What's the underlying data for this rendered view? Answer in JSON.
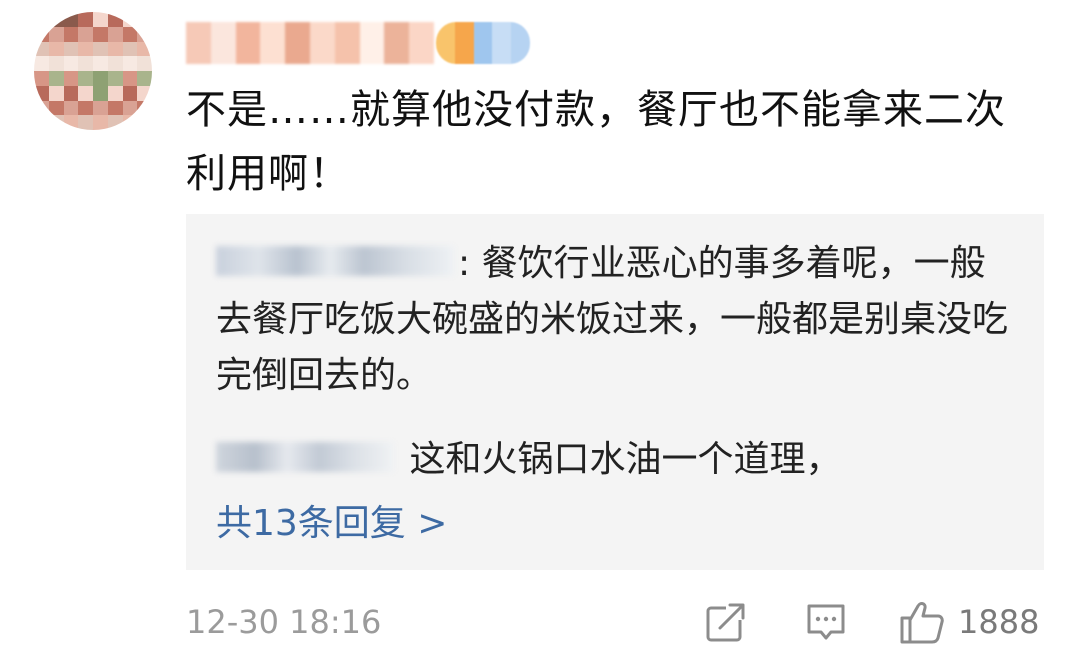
{
  "comment": {
    "text": "不是……就算他没付款，餐厅也不能拿来二次利用啊！",
    "timestamp": "12-30 18:16",
    "like_count": "1888"
  },
  "replies": [
    {
      "text": ": 餐饮行业恶心的事多着呢，一般去餐厅吃饭大碗盛的米饭过来，一般都是别桌没吃完倒回去的。"
    },
    {
      "text": " 这和火锅口水油一个道理，"
    }
  ],
  "more_replies_label": "共13条回复 >",
  "icons": {
    "share": "share-icon",
    "reply": "comment-icon",
    "like": "thumbs-up-icon"
  },
  "colors": {
    "link": "#3d6aa3",
    "reply_bg": "#f4f4f4",
    "meta": "#9b9b9b"
  }
}
